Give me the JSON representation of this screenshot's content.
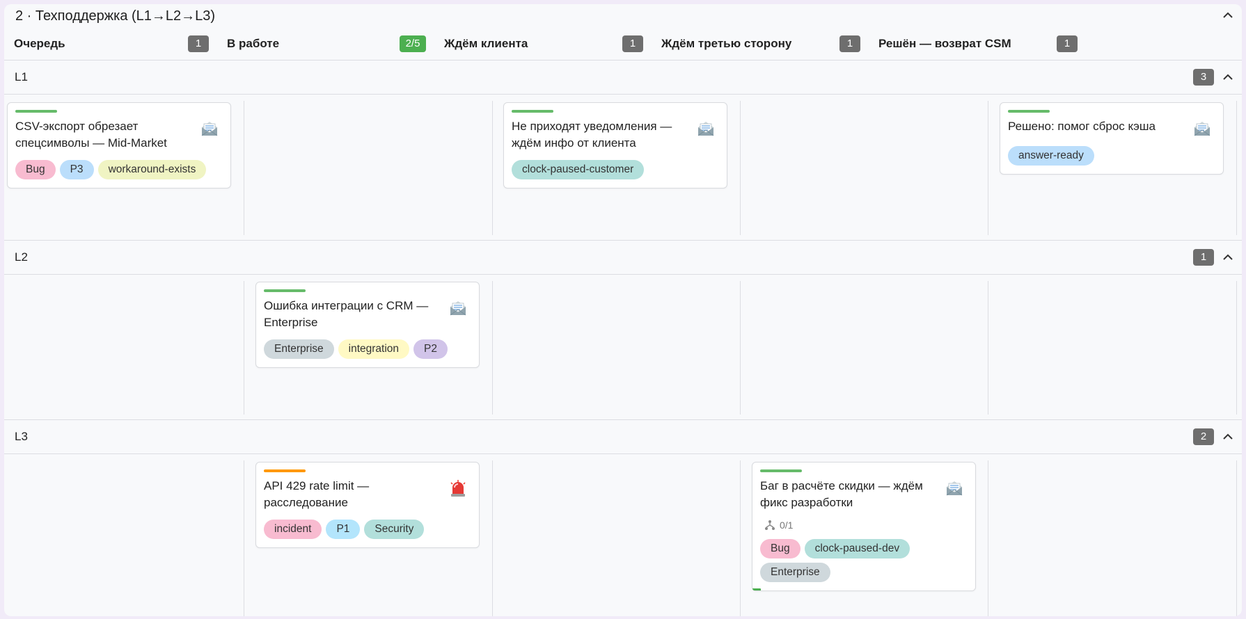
{
  "board": {
    "title": "2 · Техподдержка (L1→L2→L3)"
  },
  "columns": [
    {
      "title": "Очередь",
      "count": "1"
    },
    {
      "title": "В работе",
      "count": "2/5"
    },
    {
      "title": "Ждём клиента",
      "count": "1"
    },
    {
      "title": "Ждём третью сторону",
      "count": "1"
    },
    {
      "title": "Решён — возврат CSM",
      "count": "1"
    }
  ],
  "lanes": [
    {
      "title": "L1",
      "count": "3"
    },
    {
      "title": "L2",
      "count": "1"
    },
    {
      "title": "L3",
      "count": "2"
    }
  ],
  "cards": [
    {
      "title": "CSV-экспорт обрезает спецсимволы — Mid-Market",
      "icon": "mail-icon",
      "stripe_color": "#66bb6a",
      "tags": [
        {
          "label": "Bug",
          "color": "#f8bbd0"
        },
        {
          "label": "P3",
          "color": "#bbdefb"
        },
        {
          "label": "workaround-exists",
          "color": "#f0f4c3"
        }
      ]
    },
    {
      "title": "Не приходят уведомления — ждём инфо от клиента",
      "icon": "mail-icon",
      "stripe_color": "#66bb6a",
      "tags": [
        {
          "label": "clock-paused-customer",
          "color": "#b2dfdb"
        }
      ]
    },
    {
      "title": "Решено: помог сброс кэша",
      "icon": "mail-icon",
      "stripe_color": "#66bb6a",
      "tags": [
        {
          "label": "answer-ready",
          "color": "#bbdefb"
        }
      ]
    },
    {
      "title": "Ошибка интеграции с CRM — Enterprise",
      "icon": "mail-icon",
      "stripe_color": "#66bb6a",
      "tags": [
        {
          "label": "Enterprise",
          "color": "#cfd8dc"
        },
        {
          "label": "integration",
          "color": "#fff9c4"
        },
        {
          "label": "P2",
          "color": "#d1c4e9"
        }
      ]
    },
    {
      "title": "API 429 rate limit — расследование",
      "icon": "siren-icon",
      "stripe_color": "#ff9800",
      "tags": [
        {
          "label": "incident",
          "color": "#f8bbd0"
        },
        {
          "label": "P1",
          "color": "#b3e5fc"
        },
        {
          "label": "Security",
          "color": "#b2dfdb"
        }
      ]
    },
    {
      "title": "Баг в расчёте скидки — ждём фикс разработки",
      "icon": "mail-icon",
      "stripe_color": "#66bb6a",
      "subtasks": "0/1",
      "tags": [
        {
          "label": "Bug",
          "color": "#f8bbd0"
        },
        {
          "label": "clock-paused-dev",
          "color": "#b2dfdb"
        },
        {
          "label": "Enterprise",
          "color": "#cfd8dc"
        }
      ]
    }
  ]
}
